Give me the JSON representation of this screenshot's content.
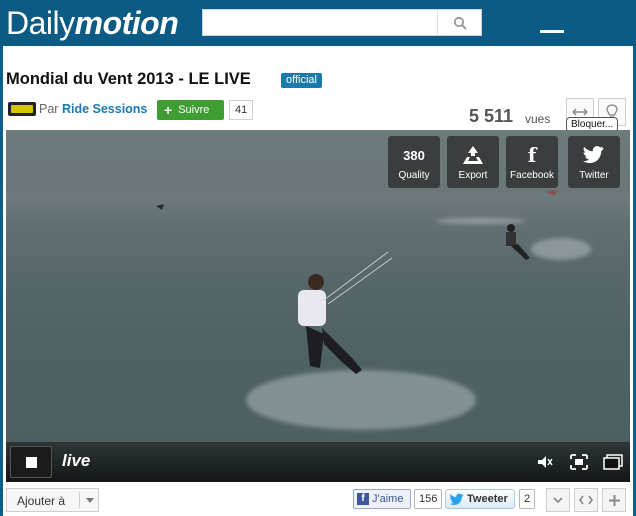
{
  "header": {
    "logo_light": "Daily",
    "logo_bold": "motion",
    "search": {
      "value": "",
      "placeholder": ""
    }
  },
  "video": {
    "title": "Mondial du Vent 2013 - LE LIVE",
    "badge": "official",
    "by_label": "Par",
    "channel": "Ride Sessions",
    "follow_label": "Suivre",
    "followers": "41",
    "views": "5 511",
    "views_label": "vues",
    "tooltip": "Bloquer..."
  },
  "overlay": {
    "buttons": [
      {
        "icon": "380",
        "label": "Quality"
      },
      {
        "icon": "export-icon",
        "label": "Export"
      },
      {
        "icon": "f",
        "label": "Facebook"
      },
      {
        "icon": "twitter-icon",
        "label": "Twitter"
      }
    ]
  },
  "player": {
    "status": "live"
  },
  "toolbar": {
    "add_label": "Ajouter à",
    "like_label": "J'aime",
    "like_count": "156",
    "tweet_label": "Tweeter",
    "tweet_count": "2"
  },
  "colors": {
    "brand": "#0b5b84",
    "follow": "#3e9e32",
    "link": "#1a79ad"
  }
}
